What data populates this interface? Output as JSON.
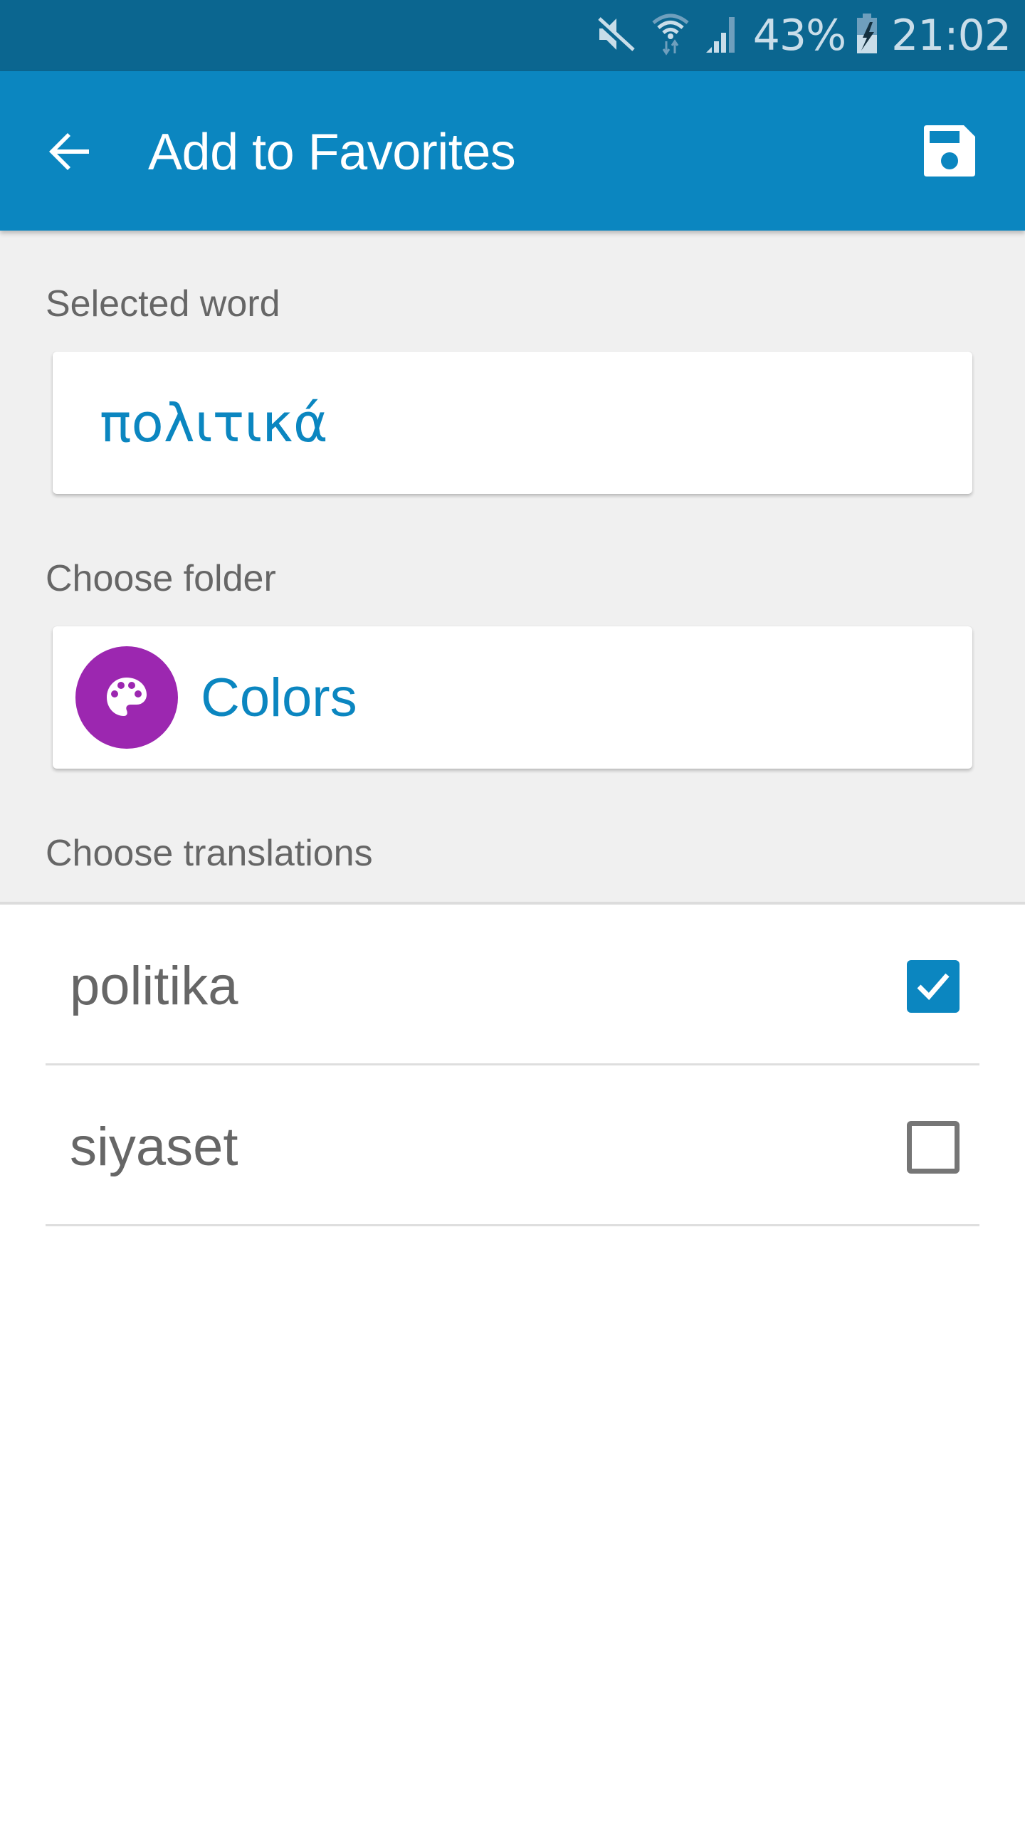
{
  "status_bar": {
    "icons": [
      "mute-icon",
      "wifi-icon",
      "signal-icon",
      "battery-charging-icon"
    ],
    "battery_percent": "43%",
    "time": "21:02"
  },
  "app_bar": {
    "back_icon": "arrow-left-icon",
    "title": "Add to Favorites",
    "save_icon": "floppy-disk-icon"
  },
  "selected_word": {
    "label": "Selected word",
    "value": "πολιτικά"
  },
  "folder": {
    "label": "Choose folder",
    "name": "Colors",
    "icon": "palette-icon",
    "icon_color": "#9c27b0"
  },
  "translations": {
    "label": "Choose translations",
    "items": [
      {
        "text": "politika",
        "checked": true
      },
      {
        "text": "siyaset",
        "checked": false
      }
    ]
  },
  "colors": {
    "primary": "#0b86c0",
    "status_bar": "#0b6690",
    "background_gray": "#f0f0f0",
    "text_gray": "#666666"
  }
}
